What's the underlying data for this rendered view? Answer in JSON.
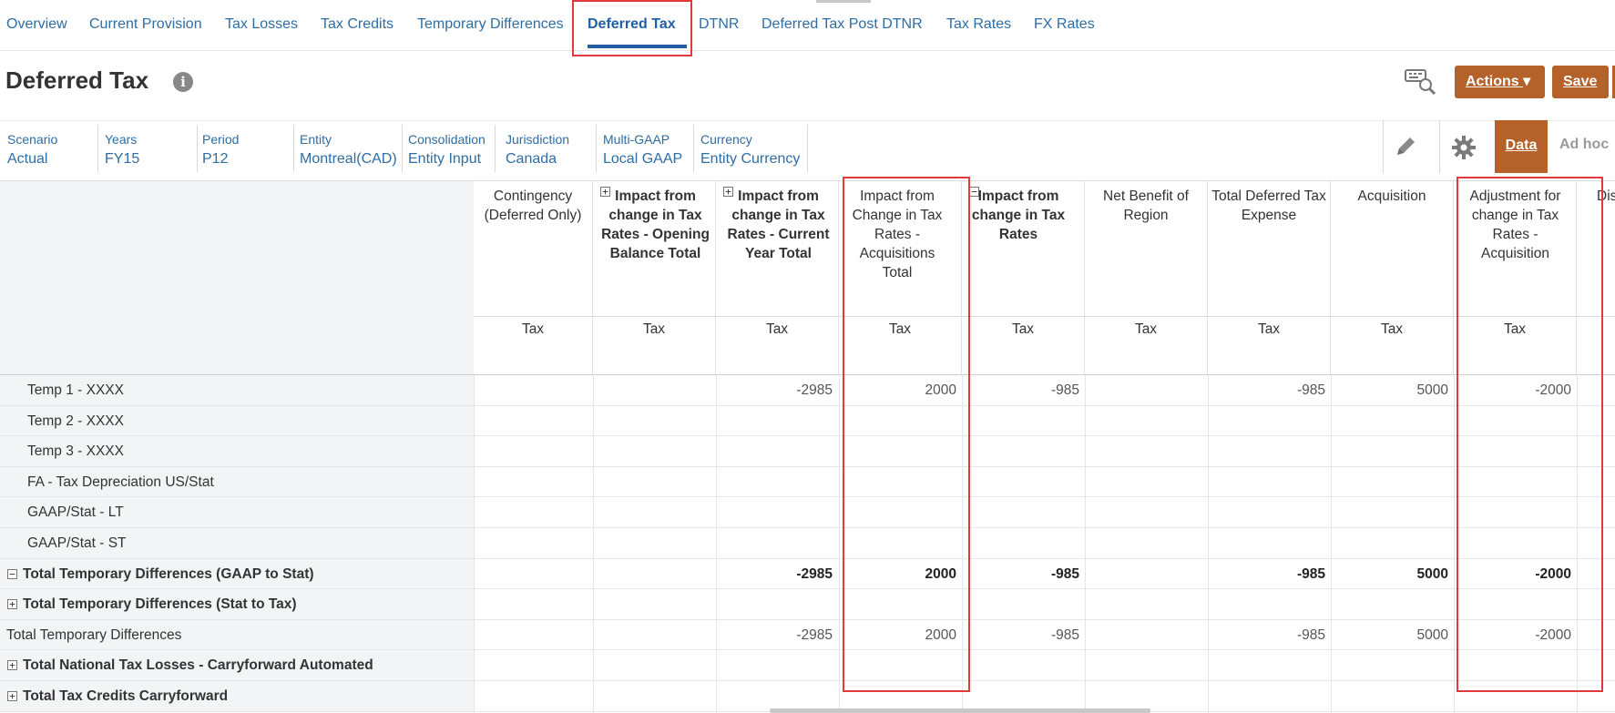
{
  "tabs": [
    "Overview",
    "Current Provision",
    "Tax Losses",
    "Tax Credits",
    "Temporary Differences",
    "Deferred Tax",
    "DTNR",
    "Deferred Tax Post DTNR",
    "Tax Rates",
    "FX Rates"
  ],
  "active_tab": "Deferred Tax",
  "header": {
    "title": "Deferred Tax",
    "info_glyph": "i",
    "actions_label": "Actions",
    "actions_caret": "▾",
    "save_label": "Save"
  },
  "pov": [
    {
      "label": "Scenario",
      "value": "Actual"
    },
    {
      "label": "Years",
      "value": "FY15"
    },
    {
      "label": "Period",
      "value": "P12"
    },
    {
      "label": "Entity",
      "value": "Montreal(CAD)"
    },
    {
      "label": "Consolidation",
      "value": "Entity Input"
    },
    {
      "label": "Jurisdiction",
      "value": "Canada"
    },
    {
      "label": "Multi-GAAP",
      "value": "Local GAAP"
    },
    {
      "label": "Currency",
      "value": "Entity Currency"
    }
  ],
  "view_tabs": {
    "data": "Data",
    "adhoc": "Ad hoc"
  },
  "columns": [
    {
      "title": "Contingency (Deferred Only)",
      "sub": "Tax"
    },
    {
      "title": "Impact from change in Tax Rates - Opening Balance Total",
      "sub": "Tax"
    },
    {
      "title": "Impact from change in Tax Rates - Current Year Total",
      "sub": "Tax"
    },
    {
      "title": "Impact from Change in Tax Rates - Acquisitions Total",
      "sub": "Tax"
    },
    {
      "title": "Impact from change in Tax Rates",
      "sub": "Tax"
    },
    {
      "title": "Net Benefit of Region",
      "sub": "Tax"
    },
    {
      "title": "Total Deferred Tax Expense",
      "sub": "Tax"
    },
    {
      "title": "Acquisition",
      "sub": "Tax"
    },
    {
      "title": "Adjustment for change in Tax Rates - Acquisition",
      "sub": "Tax"
    },
    {
      "title": "Dis",
      "sub": ""
    }
  ],
  "rows": [
    {
      "label": "Temp 1 - XXXX",
      "values": [
        "",
        "",
        "-2985",
        "2000",
        "-985",
        "",
        "-985",
        "5000",
        "-2000"
      ]
    },
    {
      "label": "Temp 2 - XXXX",
      "values": [
        "",
        "",
        "",
        "",
        "",
        "",
        "",
        "",
        ""
      ]
    },
    {
      "label": "Temp 3 - XXXX",
      "values": [
        "",
        "",
        "",
        "",
        "",
        "",
        "",
        "",
        ""
      ]
    },
    {
      "label": "FA - Tax Depreciation US/Stat",
      "values": [
        "",
        "",
        "",
        "",
        "",
        "",
        "",
        "",
        ""
      ]
    },
    {
      "label": "GAAP/Stat - LT",
      "values": [
        "",
        "",
        "",
        "",
        "",
        "",
        "",
        "",
        ""
      ]
    },
    {
      "label": "GAAP/Stat - ST",
      "values": [
        "",
        "",
        "",
        "",
        "",
        "",
        "",
        "",
        ""
      ]
    },
    {
      "label": "Total Temporary Differences (GAAP to Stat)",
      "values": [
        "",
        "",
        "-2985",
        "2000",
        "-985",
        "",
        "-985",
        "5000",
        "-2000"
      ]
    },
    {
      "label": "Total Temporary Differences (Stat to Tax)",
      "values": [
        "",
        "",
        "",
        "",
        "",
        "",
        "",
        "",
        ""
      ]
    },
    {
      "label": "Total Temporary Differences",
      "values": [
        "",
        "",
        "-2985",
        "2000",
        "-985",
        "",
        "-985",
        "5000",
        "-2000"
      ]
    },
    {
      "label": "Total National Tax Losses - Carryforward Automated",
      "values": [
        "",
        "",
        "",
        "",
        "",
        "",
        "",
        "",
        ""
      ]
    },
    {
      "label": "Total Tax Credits Carryforward",
      "values": [
        "",
        "",
        "",
        "",
        "",
        "",
        "",
        "",
        ""
      ]
    }
  ],
  "expand_glyphs": {
    "expand": "+",
    "collapse": "−"
  },
  "colors": {
    "accent": "#b4612a",
    "link": "#2e6da4",
    "highlight": "#e03a3a"
  }
}
